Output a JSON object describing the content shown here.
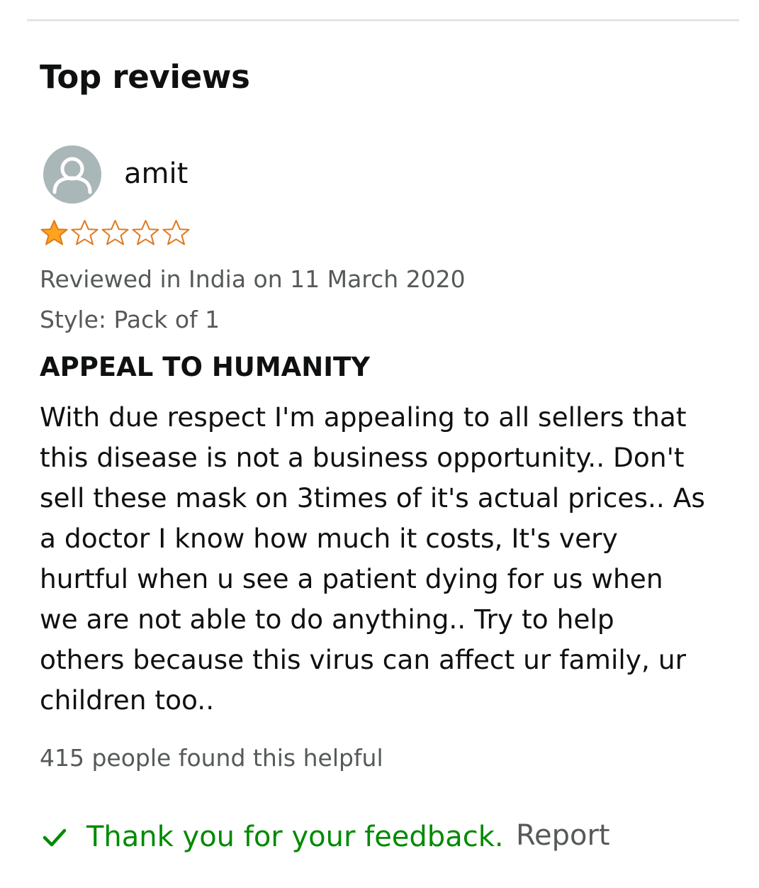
{
  "section": {
    "title": "Top reviews"
  },
  "review": {
    "author": "amit",
    "rating": 1,
    "rating_max": 5,
    "date_line": "Reviewed in India on 11 March 2020",
    "style_line": "Style: Pack of 1",
    "title": "APPEAL TO HUMANITY",
    "body_lines": [
      "With due respect I'm appealing to all sellers that",
      "this disease is not a business opportunity.. Don't",
      "sell these mask on 3times of it's actual prices.. As",
      "a doctor I know how much it costs, It's very",
      "hurtful when u see a patient dying for us when",
      "we are not able to do anything.. Try to help",
      "others because this virus can affect ur family, ur",
      "children too.."
    ],
    "helpful_text": "415 people found this helpful",
    "feedback_text": "Thank you for your feedback.",
    "report_label": "Report"
  },
  "icons": {
    "avatar": "user-avatar-icon",
    "star_filled": "star-filled-icon",
    "star_empty": "star-empty-icon",
    "check": "check-icon"
  },
  "colors": {
    "star_fill": "#ffa41c",
    "star_outline": "#de7921",
    "feedback_green": "#008a00",
    "meta_gray": "#565959",
    "avatar_bg": "#aab7b8"
  }
}
